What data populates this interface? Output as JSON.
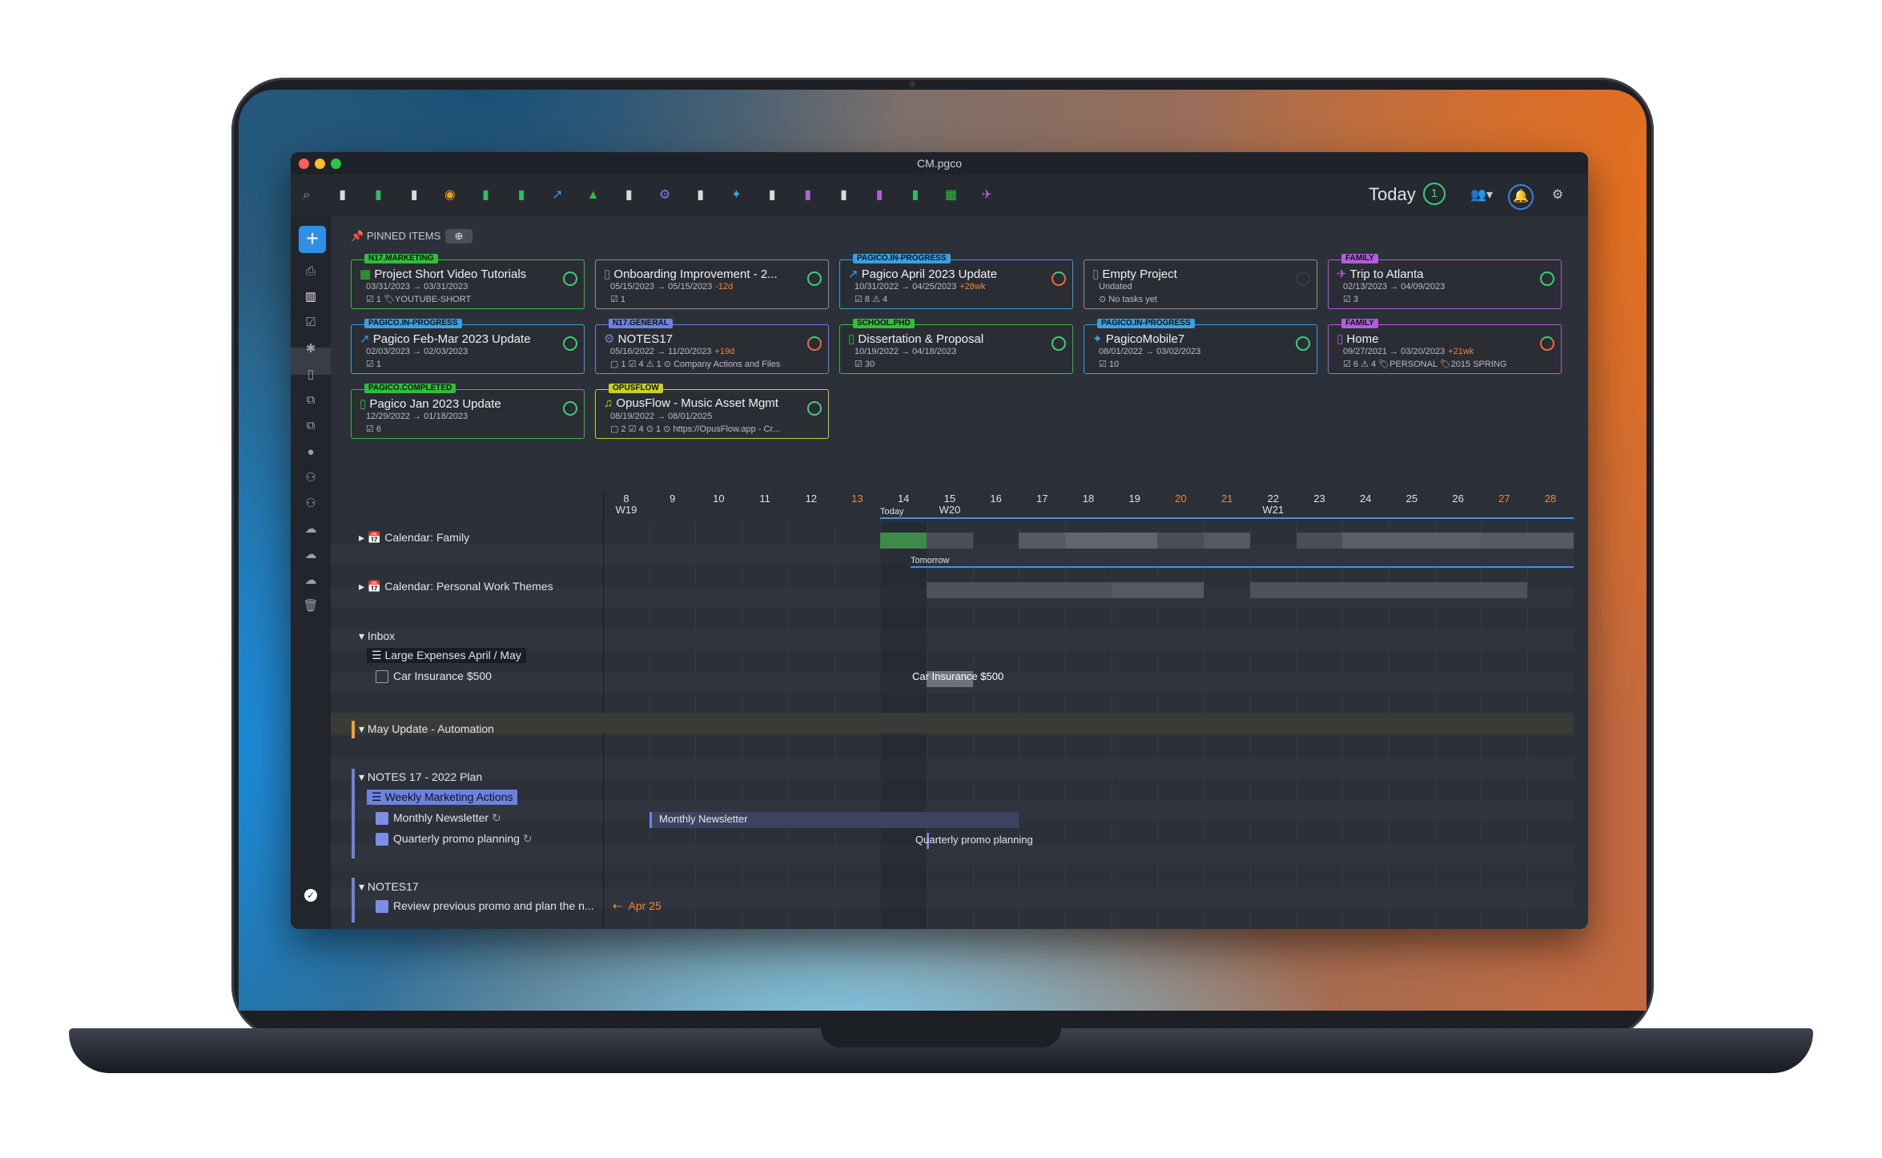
{
  "window": {
    "title": "CM.pgco"
  },
  "toolbar": {
    "today_label": "Today",
    "today_count": "1",
    "icons": [
      "search-icon",
      "document-icon",
      "document-icon",
      "document-icon",
      "eye-icon",
      "document-icon",
      "document-icon",
      "chart-icon",
      "warning-icon",
      "document-icon",
      "network-icon",
      "document-icon",
      "bulb-icon",
      "document-icon",
      "document-icon",
      "document-icon",
      "document-icon",
      "document-icon",
      "film-icon",
      "plane-icon"
    ]
  },
  "pinned": {
    "header": "PINNED ITEMS",
    "cards": [
      {
        "tag": "N17.MARKETING",
        "title": "Project Short Video Tutorials",
        "dates": "03/31/2023 → 03/31/2023",
        "meta": "☑ 1   🏷YOUTUBE-SHORT",
        "color": "#2fbf3a",
        "icon": "film-icon"
      },
      {
        "tag": "",
        "title": "Onboarding Improvement - 2...",
        "dates": "05/15/2023 → 05/15/2023",
        "extra": "-12d",
        "meta": "☑ 1",
        "color": "#8a8f99",
        "icon": "document-icon"
      },
      {
        "tag": "PAGICO.IN-PROGRESS",
        "title": "Pagico April 2023 Update",
        "dates": "10/31/2022 → 04/25/2023",
        "extra": "+28wk",
        "meta": "☑ 8  ⚠ 4",
        "color": "#3aa0e0",
        "icon": "chart-icon"
      },
      {
        "tag": "",
        "title": "Empty Project",
        "dates": "Undated",
        "meta": "⊙ No tasks yet",
        "color": "#8a8f99",
        "icon": "document-icon"
      },
      {
        "tag": "FAMILY",
        "title": "Trip to Atlanta",
        "dates": "02/13/2023 → 04/09/2023",
        "meta": "☑ 3",
        "color": "#b05ed8",
        "icon": "plane-icon"
      },
      {
        "tag": "PAGICO.IN-PROGRESS",
        "title": "Pagico Feb-Mar 2023 Update",
        "dates": "02/03/2023 → 02/03/2023",
        "meta": "☑ 1",
        "color": "#3aa0e0",
        "icon": "chart-icon"
      },
      {
        "tag": "N17.GENERAL",
        "title": "NOTES17",
        "dates": "05/16/2022 → 11/20/2023",
        "extra": "+19d",
        "meta": "▢ 1  ☑ 4  ⚠ 1  ⊙ Company Actions and Files",
        "color": "#6d82e0",
        "icon": "network-icon"
      },
      {
        "tag": "SCHOOL.PHD",
        "title": "Dissertation & Proposal",
        "dates": "10/19/2022 → 04/18/2023",
        "meta": "☑ 30",
        "color": "#2fbf3a",
        "icon": "document-icon"
      },
      {
        "tag": "PAGICO.IN-PROGRESS",
        "title": "PagicoMobile7",
        "dates": "08/01/2022 → 03/02/2023",
        "meta": "☑ 10",
        "color": "#3aa0e0",
        "icon": "bulb-icon"
      },
      {
        "tag": "FAMILY",
        "title": "Home",
        "dates": "09/27/2021 → 03/20/2023",
        "extra": "+21wk",
        "meta": "☑ 6  ⚠ 4  🏷PERSONAL 🏷2015 SPRING",
        "color": "#b05ed8",
        "icon": "document-icon"
      },
      {
        "tag": "PAGICO.COMPLETED",
        "title": "Pagico Jan 2023 Update",
        "dates": "12/29/2022 → 01/18/2023",
        "meta": "☑ 6",
        "color": "#2fbf3a",
        "icon": "document-icon"
      },
      {
        "tag": "OPUSFLOW",
        "title": "OpusFlow - Music Asset Mgmt",
        "dates": "08/19/2022 → 08/01/2025",
        "meta": "▢ 2  ☑ 4  ⊙ 1  ⊙ https://OpusFlow.app - Cr...",
        "color": "#c8d02a",
        "icon": "music-icon"
      }
    ]
  },
  "timeline": {
    "days": [
      {
        "d": "8",
        "w": "W19"
      },
      {
        "d": "9"
      },
      {
        "d": "10"
      },
      {
        "d": "11"
      },
      {
        "d": "12"
      },
      {
        "d": "13",
        "we": true
      },
      {
        "d": "14",
        "today": true
      },
      {
        "d": "15",
        "w": "W20"
      },
      {
        "d": "16"
      },
      {
        "d": "17"
      },
      {
        "d": "18"
      },
      {
        "d": "19"
      },
      {
        "d": "20",
        "we": true
      },
      {
        "d": "21",
        "we": true
      },
      {
        "d": "22",
        "w": "W21"
      },
      {
        "d": "23"
      },
      {
        "d": "24"
      },
      {
        "d": "25"
      },
      {
        "d": "26"
      },
      {
        "d": "27",
        "we": true
      },
      {
        "d": "28",
        "we": true
      }
    ],
    "today_label": "Today",
    "tomorrow_label": "Tomorrow",
    "rows": {
      "cal_family": "Calendar: Family",
      "cal_work": "Calendar: Personal Work Themes",
      "inbox": "Inbox",
      "large_expenses": "Large Expenses April / May",
      "car_insurance": "Car Insurance $500",
      "car_insurance_bar": "Car Insurance $500",
      "may_update": "May Update - Automation",
      "notes_plan": "NOTES 17 - 2022 Plan",
      "weekly_marketing": "Weekly Marketing Actions",
      "monthly_newsletter": "Monthly Newsletter",
      "monthly_newsletter_bar": "Monthly Newsletter",
      "quarterly_promo": "Quarterly promo planning",
      "quarterly_promo_bar": "Quarterly promo planning",
      "notes17": "NOTES17",
      "review_promo": "Review previous promo and plan the n...",
      "review_due": "Apr 25"
    }
  },
  "colors": {
    "accent": "#2f8fe6",
    "today_line": "#4a8fd8",
    "green": "#2fbf3a",
    "overdue": "#f0883a"
  }
}
